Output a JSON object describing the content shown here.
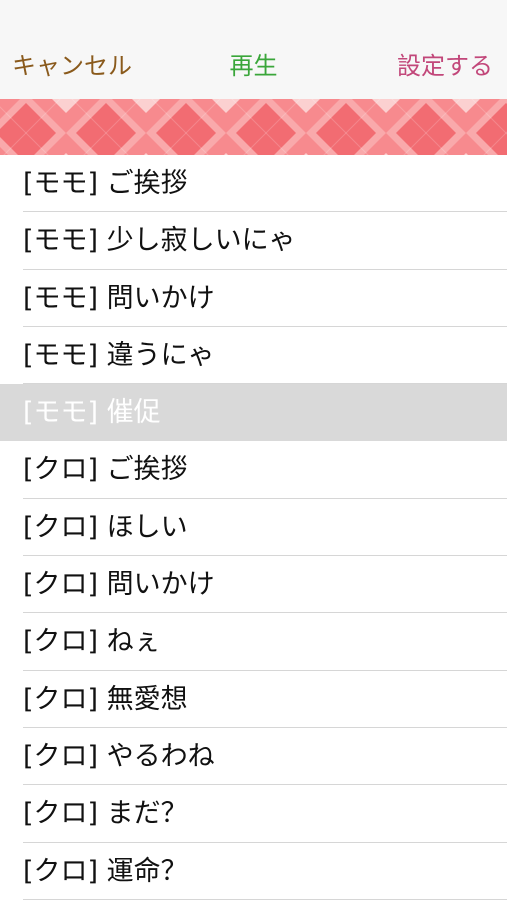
{
  "colors": {
    "cancel": "#8a5a1c",
    "play": "#3aa63a",
    "settings": "#c2477a",
    "banner_pink": "#f77f84",
    "banner_dark": "#f2636b",
    "selected_row": "#d9d9d9"
  },
  "navbar": {
    "cancel_label": "キャンセル",
    "play_label": "再生",
    "settings_label": "設定する"
  },
  "list": {
    "items": [
      {
        "label": "[モモ] ご挨拶",
        "selected": false
      },
      {
        "label": "[モモ] 少し寂しいにゃ",
        "selected": false
      },
      {
        "label": "[モモ] 問いかけ",
        "selected": false
      },
      {
        "label": "[モモ] 違うにゃ",
        "selected": false
      },
      {
        "label": "[モモ] 催促",
        "selected": true
      },
      {
        "label": "[クロ] ご挨拶",
        "selected": false
      },
      {
        "label": "[クロ] ほしい",
        "selected": false
      },
      {
        "label": "[クロ] 問いかけ",
        "selected": false
      },
      {
        "label": "[クロ] ねぇ",
        "selected": false
      },
      {
        "label": "[クロ] 無愛想",
        "selected": false
      },
      {
        "label": "[クロ] やるわね",
        "selected": false
      },
      {
        "label": "[クロ] まだ？",
        "selected": false
      },
      {
        "label": "[クロ] 運命？",
        "selected": false
      }
    ]
  }
}
